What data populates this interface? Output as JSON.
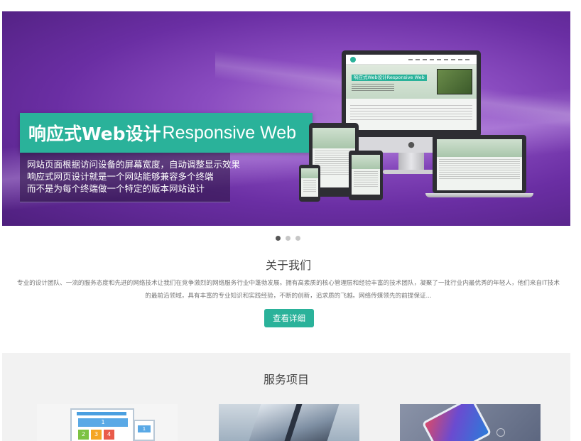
{
  "banner": {
    "headline_bold": "响应式Web设计",
    "headline_light": "Responsive Web",
    "description": [
      "网站页面根据访问设备的屏幕宽度，自动调整显示效果",
      "响应式网页设计就是一个网站能够兼容多个终端",
      "而不是为每个终端做一个特定的版本网站设计"
    ],
    "device_screen_tag": "响应式Web设计Responsive Web",
    "colors": {
      "background": "#6a2ea3",
      "accent": "#2ab29a"
    }
  },
  "carousel": {
    "slide_count": 3,
    "active_index": 0
  },
  "about": {
    "title": "关于我们",
    "text": "专业的设计团队、一流的服务态度和先进的网络技术让我们在竞争激烈的网络服务行业中蓬勃发展。拥有高素质的核心管理层和经验丰富的技术团队，凝聚了一批行业内最优秀的年轻人，他们来自IT技术的最前沿领域，具有丰富的专业知识和实践经验，不断的创新，追求质的飞越。网络传媒领先的前提保证...",
    "button_label": "查看详细"
  },
  "services": {
    "title": "服务项目",
    "card1_numbers": [
      "1",
      "2",
      "3",
      "4",
      "1"
    ]
  }
}
